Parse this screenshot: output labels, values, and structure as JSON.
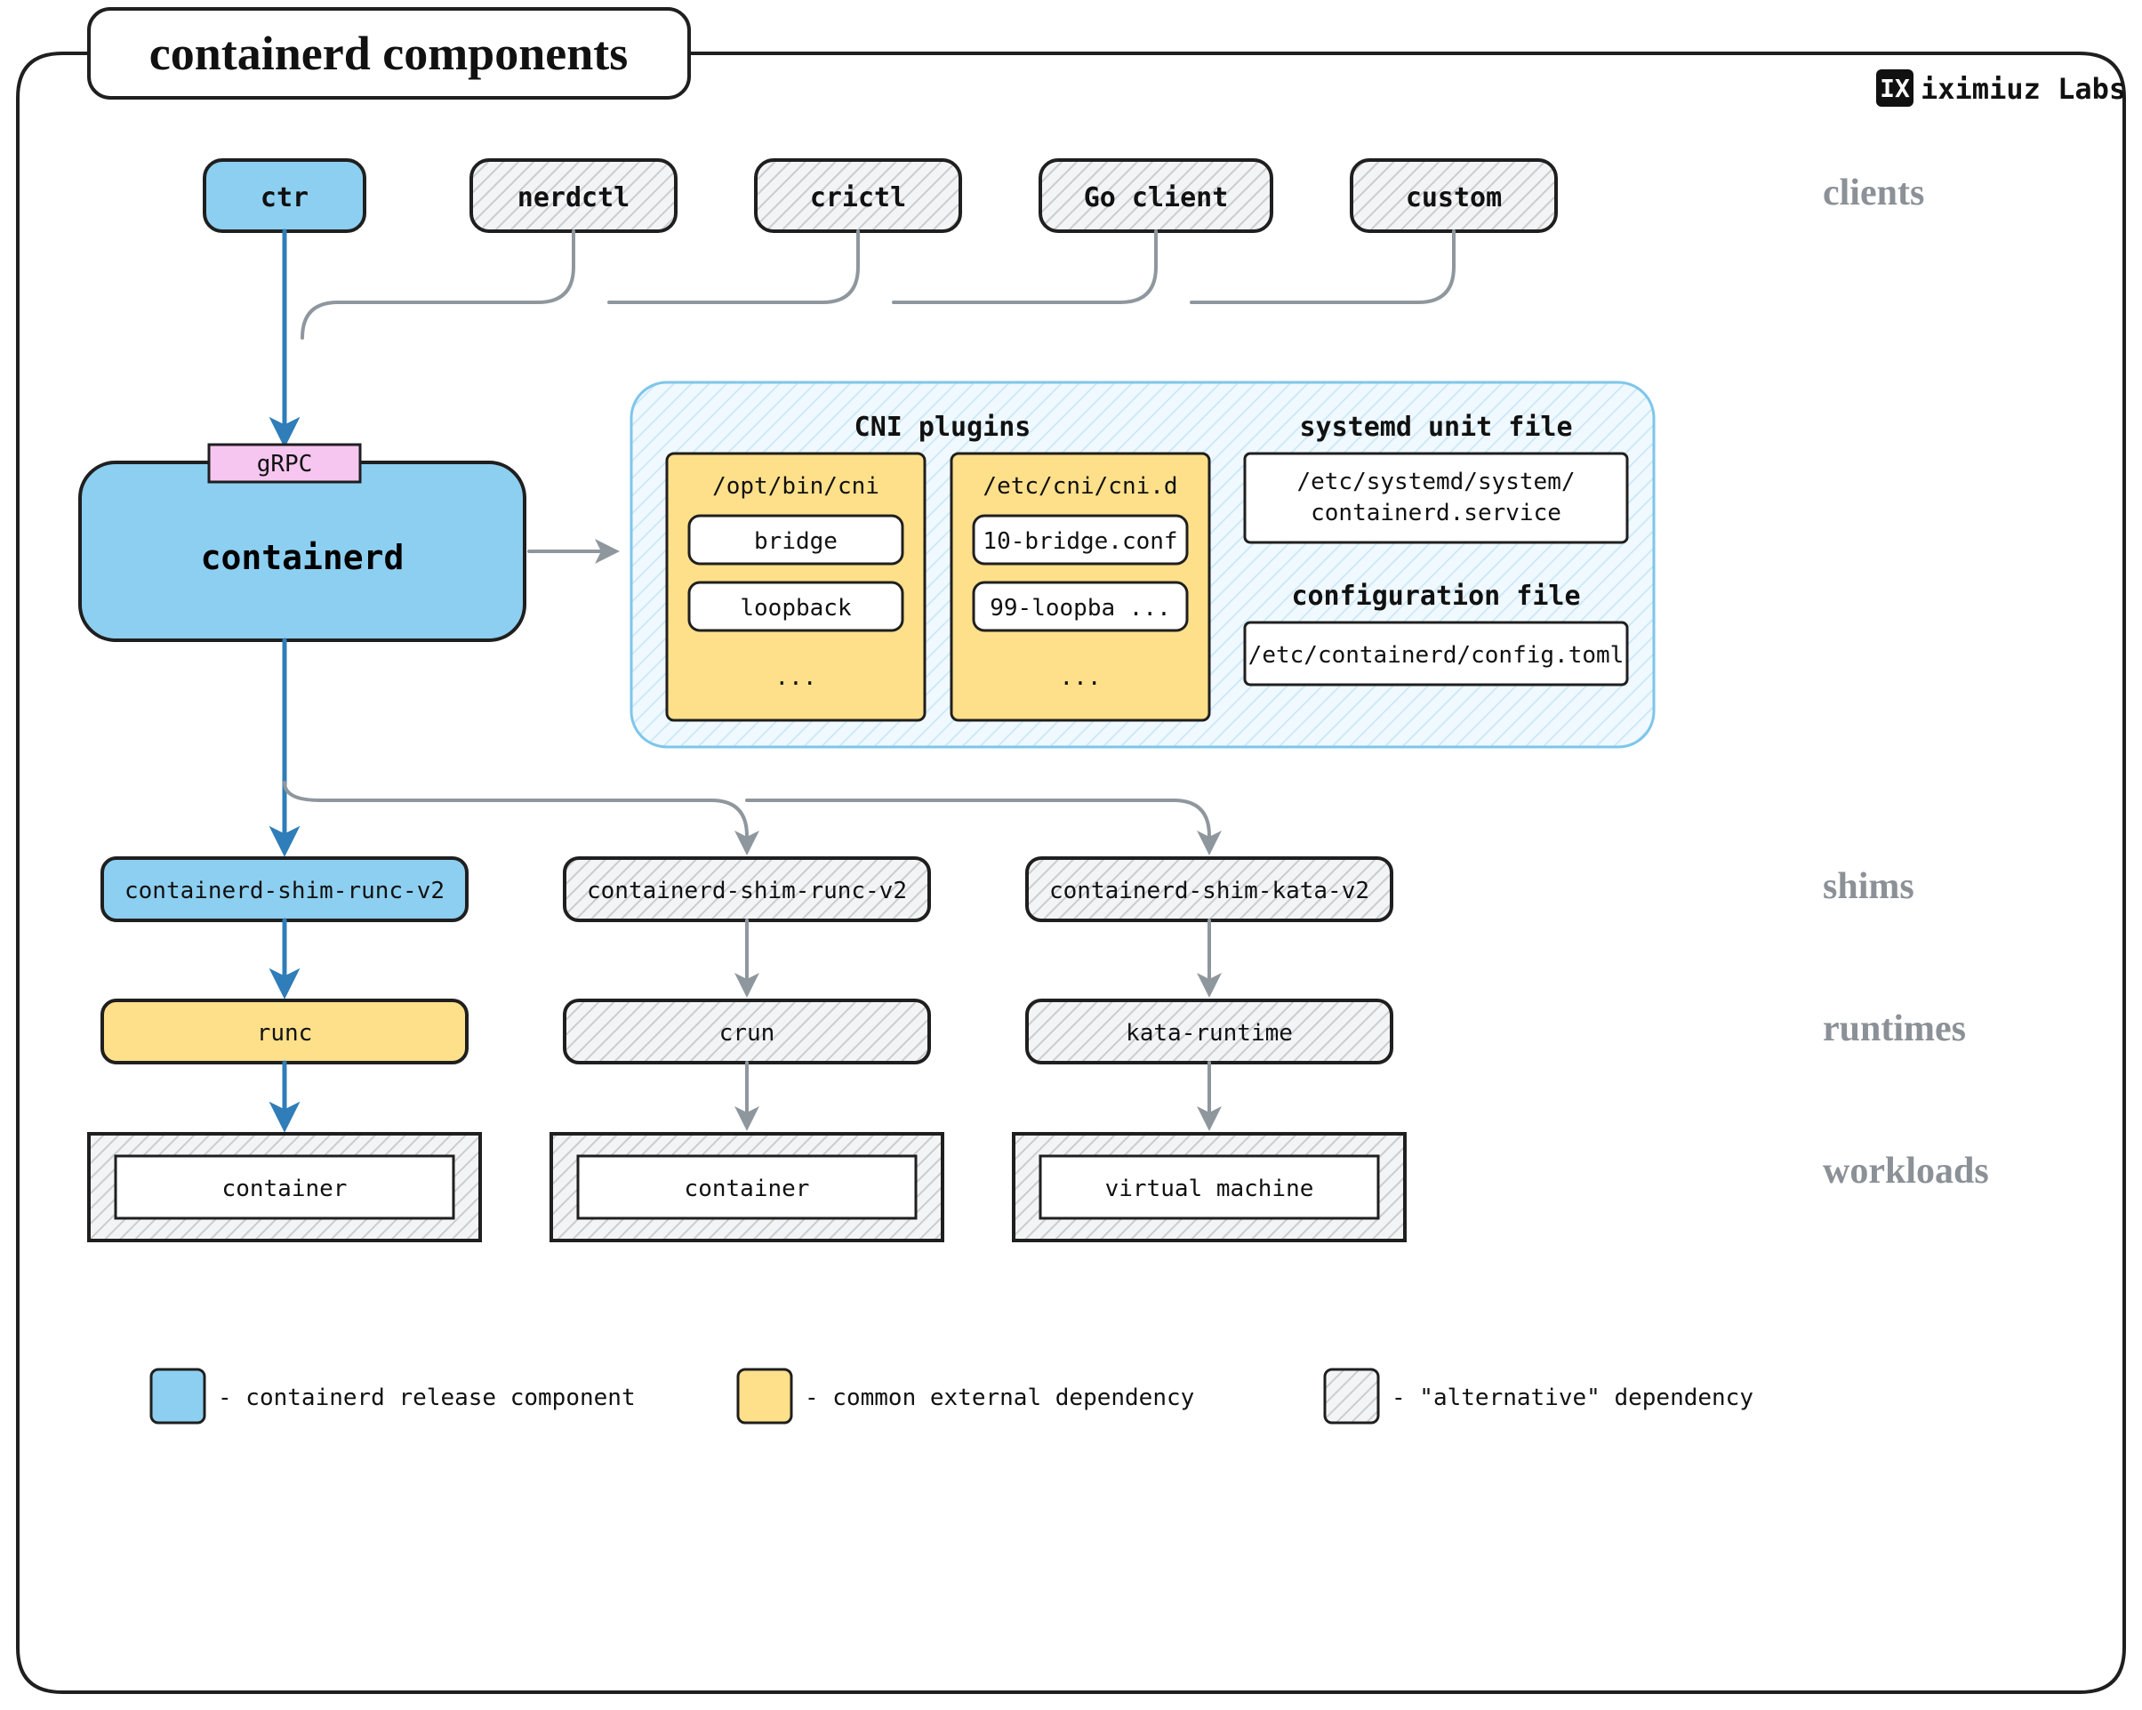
{
  "title": "containerd components",
  "watermark": "iximiuz Labs",
  "sections": {
    "clients": "clients",
    "shims": "shims",
    "runtimes": "runtimes",
    "workloads": "workloads"
  },
  "clients": {
    "ctr": "ctr",
    "nerdctl": "nerdctl",
    "crictl": "crictl",
    "go_client": "Go client",
    "custom": "custom"
  },
  "core": {
    "label": "containerd",
    "grpc": "gRPC"
  },
  "sidepanel": {
    "cni_title": "CNI plugins",
    "cni_left_path": "/opt/bin/cni",
    "cni_left_a": "bridge",
    "cni_left_b": "loopback",
    "cni_left_more": "...",
    "cni_right_path": "/etc/cni/cni.d",
    "cni_right_a": "10-bridge.conf",
    "cni_right_b": "99-loopba ...",
    "cni_right_more": "...",
    "unit_title": "systemd unit file",
    "unit_path_a": "/etc/systemd/system/",
    "unit_path_b": "containerd.service",
    "cfg_title": "configuration file",
    "cfg_path": "/etc/containerd/config.toml"
  },
  "shims": {
    "a": "containerd-shim-runc-v2",
    "b": "containerd-shim-runc-v2",
    "c": "containerd-shim-kata-v2"
  },
  "runtimes": {
    "a": "runc",
    "b": "crun",
    "c": "kata-runtime"
  },
  "workloads": {
    "a": "container",
    "b": "container",
    "c": "virtual machine"
  },
  "legend": {
    "release": "- containerd release component",
    "external": "- common external dependency",
    "alt": "- \"alternative\" dependency"
  }
}
